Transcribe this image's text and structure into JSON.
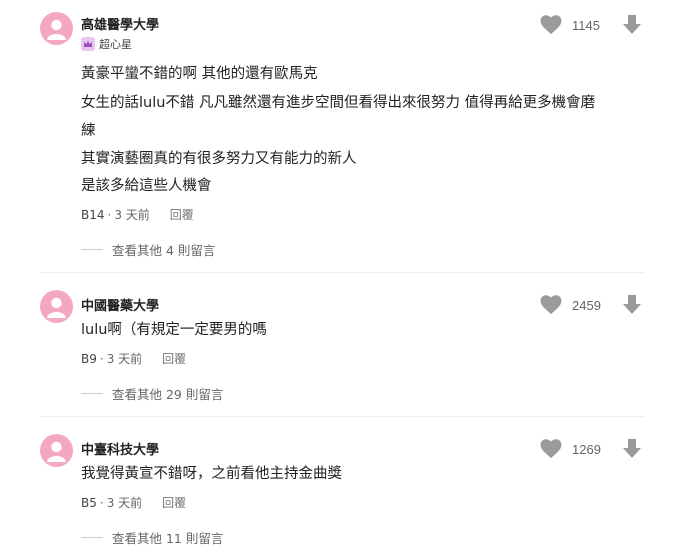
{
  "comments": [
    {
      "school": "高雄醫學大學",
      "badge": "超心星",
      "likes": "1145",
      "lines": [
        "黃豪平蠻不錯的啊 其他的還有歐馬克",
        "女生的話lulu不錯 凡凡雖然還有進步空間但看得出來很努力 值得再給更多機會磨",
        "練",
        "其實演藝圈真的有很多努力又有能力的新人",
        "是該多給這些人機會"
      ],
      "floor": "B14",
      "time": "3 天前",
      "reply": "回覆",
      "more": "查看其他 4 則留言"
    },
    {
      "school": "中國醫藥大學",
      "likes": "2459",
      "lines": [
        "lulu啊（有規定一定要男的嗎"
      ],
      "floor": "B9",
      "time": "3 天前",
      "reply": "回覆",
      "more": "查看其他 29 則留言"
    },
    {
      "school": "中臺科技大學",
      "likes": "1269",
      "lines": [
        "我覺得黃宣不錯呀，之前看他主持金曲獎"
      ],
      "floor": "B5",
      "time": "3 天前",
      "reply": "回覆",
      "more": "查看其他 11 則留言"
    }
  ],
  "icons": {
    "avatar": "dcard-avatar-icon",
    "like": "heart-icon",
    "dislike": "arrow-down-icon",
    "badge": "crown-badge-icon"
  },
  "colors": {
    "avatar_bg": "#f4a7c3",
    "icon_gray": "#9a9a9a",
    "badge_bg": "#e7c6f0"
  }
}
